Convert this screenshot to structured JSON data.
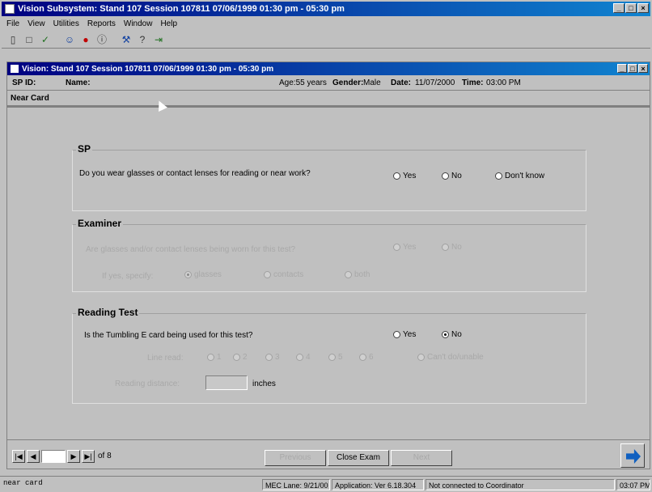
{
  "app": {
    "title": "Vision Subsystem: Stand 107 Session 107811 07/06/1999 01:30 pm - 05:30 pm",
    "window_buttons": [
      "_",
      "□",
      "×"
    ]
  },
  "menu": [
    "File",
    "View",
    "Utilities",
    "Reports",
    "Window",
    "Help"
  ],
  "toolbar": [
    {
      "icon": "open-icon",
      "glyph": "▯"
    },
    {
      "icon": "new-icon",
      "glyph": "□"
    },
    {
      "icon": "check-icon",
      "glyph": "✓"
    },
    {
      "icon": "face-icon",
      "glyph": "☺"
    },
    {
      "icon": "record-icon",
      "glyph": "●"
    },
    {
      "icon": "info-icon",
      "glyph": "ⓘ"
    },
    {
      "icon": "tools-icon",
      "glyph": "⚒"
    },
    {
      "icon": "help-icon",
      "glyph": "?"
    },
    {
      "icon": "exit-icon",
      "glyph": "⇥"
    }
  ],
  "child": {
    "title": "Vision: Stand 107 Session 107811 07/06/1999 01:30 pm - 05:30 pm",
    "info": {
      "sp_label": "SP ID:",
      "name_label": "Name:",
      "age": "Age:55 years",
      "gender_label": "Gender:",
      "gender_value": "Male",
      "date_label": "Date:",
      "date_value": "11/07/2000",
      "time_label": "Time:",
      "time_value": "03:00 PM"
    },
    "section": "Near Card"
  },
  "sp_group": {
    "legend": "SP",
    "question": "Do you wear glasses or contact lenses for reading or near work?",
    "options": [
      "Yes",
      "No",
      "Don't know"
    ]
  },
  "examiner_group": {
    "legend": "Examiner",
    "question": "Are glasses and/or contact lenses being worn for this test?",
    "q_options": [
      "Yes",
      "No"
    ],
    "type_label": "If yes, specify:",
    "type_options": [
      "glasses",
      "contacts",
      "both"
    ]
  },
  "reading_group": {
    "legend": "Reading Test",
    "question": "Is the Tumbling E card being used for this test?",
    "options": [
      "Yes",
      "No"
    ],
    "selected": "No",
    "line_label": "Line read:",
    "line_options": [
      "1",
      "2",
      "3",
      "4",
      "5",
      "6"
    ],
    "cannot_label": "Can't do/unable",
    "distance_label": "Reading distance:",
    "distance_value": "",
    "distance_unit": "inches"
  },
  "bottom": {
    "page_value": "",
    "page_of": "of 8",
    "buttons": [
      {
        "label": "Previous",
        "enabled": false
      },
      {
        "label": "Close Exam",
        "enabled": true
      },
      {
        "label": "Next",
        "enabled": false
      }
    ]
  },
  "status": {
    "left": "near card",
    "mec": "MEC Lane: 9/21/00",
    "app": "Application: Ver 6.18.304",
    "conn": "Not connected to Coordinator",
    "time": "03:07 PM"
  }
}
